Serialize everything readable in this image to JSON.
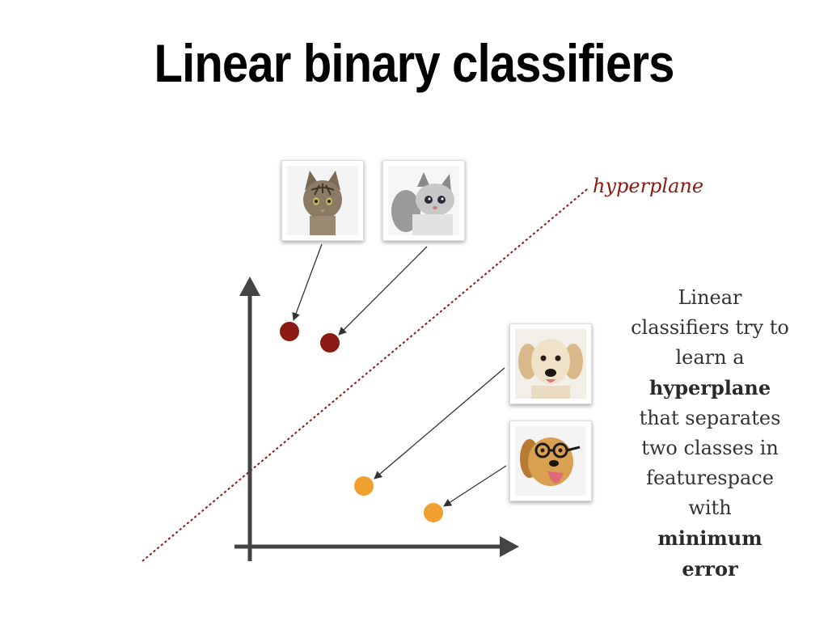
{
  "slide": {
    "title": "Linear binary classifiers",
    "hyperplane_label": "hyperplane",
    "caption": {
      "line1": "Linear",
      "line2": "classifiers try to",
      "line3": "learn a",
      "line4_bold": "hyperplane",
      "line5": "that separates",
      "line6": "two classes in",
      "line7": "featurespace",
      "line8": "with",
      "line9_bold": "minimum",
      "line10_bold": "error"
    }
  },
  "colors": {
    "cat_class": "#8b1a12",
    "dog_class": "#f0a030",
    "axes": "#444444",
    "hyperplane": "#8b1a12"
  },
  "images": [
    "tabby-cat-photo",
    "kitten-photo",
    "puppy-photo",
    "golden-retriever-with-glasses-photo"
  ]
}
